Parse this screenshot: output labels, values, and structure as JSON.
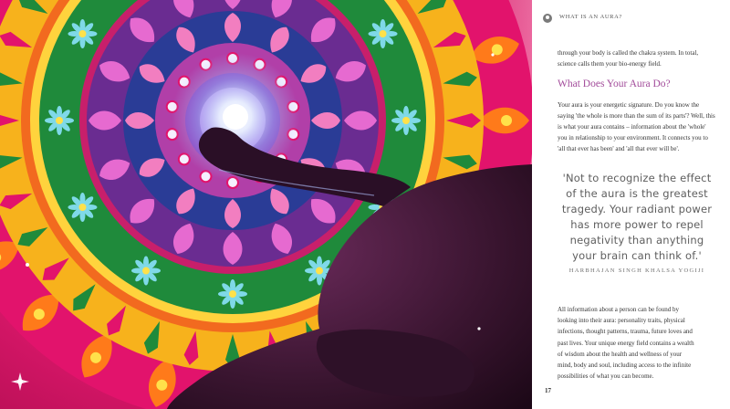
{
  "header": {
    "icon": "aura-icon",
    "section_label": "WHAT IS AN AURA?"
  },
  "content": {
    "intro_lines": [
      "through your body is called the chakra system. In total,",
      "science calls them your bio-energy field."
    ],
    "heading": "What Does Your Aura Do?",
    "body_lines": [
      "Your aura is your energetic signature. Do you know the",
      "saying 'the whole is more than the sum of its parts'? Well, this",
      "is what your aura contains – information about the 'whole'",
      "you in relationship to your environment. It connects you to",
      "'all that ever has been' and 'all that ever will be'."
    ],
    "quote_lines": [
      "'Not to recognize the effect",
      "of the aura is the greatest",
      "tragedy. Your radiant power",
      "has more power to repel",
      "negativity than anything",
      "your brain can think of.'"
    ],
    "quote_attribution": "HARBHAJAN SINGH KHALSA YOGIJI",
    "closing_lines": [
      "All information about a person can be found by",
      "looking into their aura: personality traits, physical",
      "infections, thought patterns, trauma, future loves and",
      "past lives. Your unique energy field contains a wealth",
      "of wisdom about the health and wellness of your",
      "mind, body and soul, including access to the infinite",
      "possibilities of what you can become."
    ]
  },
  "footer": {
    "page_number": "17"
  },
  "colors": {
    "heading": "#a24b9a",
    "magenta": "#e0196e",
    "orange": "#f39a1e",
    "green": "#1f8a3b",
    "purple": "#6a2c91",
    "silhouette": "#3a1530"
  }
}
